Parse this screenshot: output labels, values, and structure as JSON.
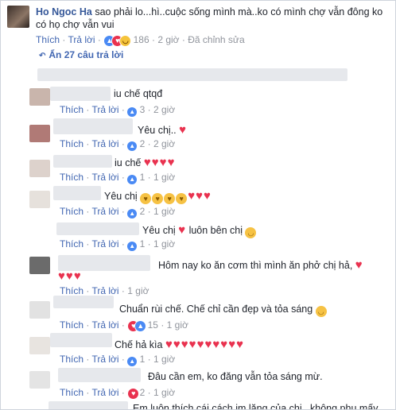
{
  "post": {
    "author": "Ho Ngoc Ha",
    "text_line1": "sao phải lo...hì..cuộc sống mình mà..ko có mình chợ vẫn đông ko",
    "text_line2": "có họ chợ vẫn vui",
    "like_label": "Thích",
    "reply_label": "Trả lời",
    "reaction_count": "186",
    "time": "2 giờ",
    "edited_label": "Đã chỉnh sửa"
  },
  "hidden_replies_label": "Ẩn 27 câu trả lời",
  "replies": [
    {
      "text": "iu chế qtqđ",
      "likes": "3",
      "time": "2 giờ"
    },
    {
      "text": "Yêu chị..",
      "likes": "2",
      "time": "2 giờ"
    },
    {
      "text": "iu chế",
      "likes": "1",
      "time": "1 giờ"
    },
    {
      "text": "Yêu chị",
      "likes": "2",
      "time": "1 giờ"
    },
    {
      "text": "Yêu chị",
      "text_after": "luôn bên chị",
      "likes": "1",
      "time": "1 giờ"
    },
    {
      "text": "Hôm nay ko ăn cơm thì mình ăn phở chị hả,",
      "likes": "",
      "time": "1 giờ"
    },
    {
      "text": "Chuẩn rùi chế. Chế chỉ cần đẹp và tỏa sáng",
      "likes": "15",
      "time": "1 giờ"
    },
    {
      "text": "Chế hả kìa",
      "likes": "1",
      "time": "1 giờ"
    },
    {
      "text": "Đâu cần em, ko đăng vẫn tỏa sáng mừ.",
      "likes": "2",
      "time": "1 giờ"
    },
    {
      "text": "Em luôn thích cái cách im lặng của chị.. không phụ mấy",
      "likes": "",
      "time": ""
    }
  ],
  "ui": {
    "like_label": "Thích",
    "reply_label": "Trả lời",
    "dot": "·"
  },
  "icons": {
    "like": "thumbs-up-icon",
    "love": "heart-icon",
    "haha": "laugh-icon",
    "emoji": "smile-icon"
  },
  "colors": {
    "link": "#4267b2",
    "name": "#365899",
    "meta": "#90949c",
    "heart": "#e9324f",
    "like": "#4a8af4"
  }
}
